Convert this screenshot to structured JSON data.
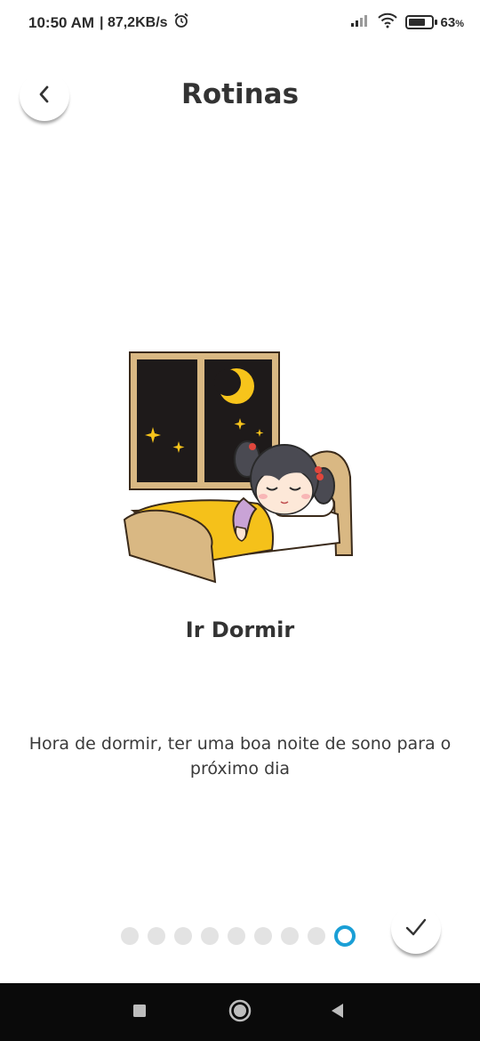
{
  "status_bar": {
    "time": "10:50 AM",
    "speed": "| 87,2KB/s",
    "battery_percent": "63",
    "battery_unit": "%",
    "battery_level": 0.63,
    "icons": [
      "alarm-icon",
      "signal-icon",
      "wifi-icon",
      "battery-icon"
    ]
  },
  "header": {
    "title": "Rotinas",
    "back_icon": "chevron-left-icon"
  },
  "routine": {
    "illustration": "girl-sleeping-in-bed-night-window",
    "title": "Ir Dormir",
    "description": "Hora de dormir, ter uma boa noite de sono para o próximo dia"
  },
  "pager": {
    "total": 9,
    "current": 9
  },
  "done_icon": "checkmark-icon",
  "nav_bar": {
    "icons": [
      "recents-square-icon",
      "home-circle-icon",
      "back-triangle-icon"
    ]
  },
  "colors": {
    "accent": "#1a9fd6",
    "inactive_dot": "#e3e3e3",
    "nav_bar": "#0a0a0a"
  }
}
